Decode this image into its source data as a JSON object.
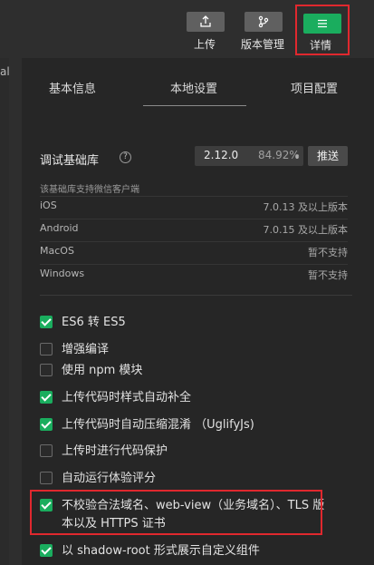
{
  "toolbar": {
    "upload_label": "上传",
    "version_label": "版本管理",
    "detail_label": "详情",
    "accent_color": "#1aad5e",
    "highlight_color": "#e0282e"
  },
  "left_strip": {
    "label": "al"
  },
  "tabs": [
    {
      "label": "基本信息"
    },
    {
      "label": "本地设置",
      "active": true
    },
    {
      "label": "项目配置"
    }
  ],
  "sdk": {
    "label": "调试基础库",
    "help_icon": "?",
    "version": "2.12.0",
    "percent": "84.92%",
    "push_label": "推送",
    "note": "该基础库支持微信客户端",
    "platforms": [
      {
        "name": "iOS",
        "value": "7.0.13 及以上版本"
      },
      {
        "name": "Android",
        "value": "7.0.15 及以上版本"
      },
      {
        "name": "MacOS",
        "value": "暂不支持"
      },
      {
        "name": "Windows",
        "value": "暂不支持"
      }
    ]
  },
  "options": [
    {
      "label": "ES6 转 ES5",
      "checked": true
    },
    {
      "label": "增强编译",
      "checked": false
    },
    {
      "label": "使用 npm 模块",
      "checked": false
    },
    {
      "label": "上传代码时样式自动补全",
      "checked": true
    },
    {
      "label": "上传代码时自动压缩混淆 （UglifyJs)",
      "checked": true
    },
    {
      "label": "上传时进行代码保护",
      "checked": false
    },
    {
      "label": "自动运行体验评分",
      "checked": false
    },
    {
      "label": "不校验合法域名、web-view（业务域名）、TLS 版本以及 HTTPS 证书",
      "checked": true
    },
    {
      "label": "以 shadow-root 形式展示自定义组件",
      "checked": true
    }
  ]
}
